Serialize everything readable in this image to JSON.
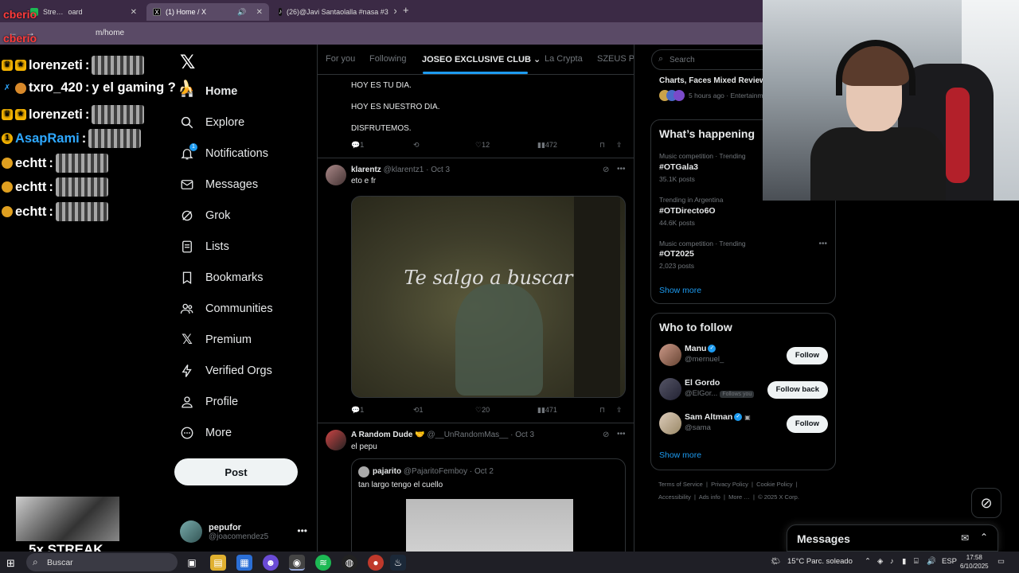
{
  "browser": {
    "tabs": [
      {
        "label": "Stre…",
        "suffix": "oard"
      },
      {
        "label": "(1) Home / X"
      },
      {
        "label": "(26)@Javi Santaolalla #nasa #3"
      }
    ],
    "url": "m/home",
    "new_tab": "+"
  },
  "stream": {
    "chat": [
      {
        "user": "lorenzeti",
        "message": ""
      },
      {
        "user": "txro_420",
        "message": "y el gaming ?"
      },
      {
        "user": "lorenzeti",
        "message": ""
      },
      {
        "user": "AsapRami",
        "message": ""
      },
      {
        "user": "echtt",
        "message": ""
      },
      {
        "user": "echtt",
        "message": ""
      },
      {
        "user": "echtt",
        "message": ""
      }
    ],
    "overlay_tag": "cberio",
    "streak": "5x STREAK",
    "colors": {
      "lorenzeti": "#ffffff",
      "asaprami": "#2ea8ff",
      "echtt": "#ffffff"
    }
  },
  "nav": {
    "items": [
      {
        "label": "Home",
        "icon": "home-icon"
      },
      {
        "label": "Explore",
        "icon": "search-icon"
      },
      {
        "label": "Notifications",
        "icon": "bell-icon",
        "badge": "1"
      },
      {
        "label": "Messages",
        "icon": "mail-icon"
      },
      {
        "label": "Grok",
        "icon": "grok-icon"
      },
      {
        "label": "Lists",
        "icon": "list-icon"
      },
      {
        "label": "Bookmarks",
        "icon": "bookmark-icon"
      },
      {
        "label": "Communities",
        "icon": "people-icon"
      },
      {
        "label": "Premium",
        "icon": "x-icon"
      },
      {
        "label": "Verified Orgs",
        "icon": "bolt-icon"
      },
      {
        "label": "Profile",
        "icon": "person-icon"
      },
      {
        "label": "More",
        "icon": "more-circle-icon"
      }
    ],
    "post_label": "Post",
    "account": {
      "name": "pepufor",
      "handle": "@joacomendez5"
    }
  },
  "timeline": {
    "tabs": [
      "For you",
      "Following",
      "JOSEO EXCLUSIVE CLUB",
      "La Crypta",
      "SZEUS Pe"
    ],
    "active_tab": "JOSEO EXCLUSIVE CLUB",
    "post1": {
      "lines": [
        "HOY ES TU DIA.",
        "HOY ES NUESTRO DIA.",
        "DISFRUTEMOS."
      ],
      "replies": "1",
      "reposts": "",
      "likes": "12",
      "views": "472"
    },
    "post2": {
      "name": "klarentz",
      "handle": "@klarentz1",
      "date": "Oct 3",
      "text": "eto e fr",
      "media_caption": "Te salgo a buscar",
      "replies": "1",
      "reposts": "1",
      "likes": "20",
      "views": "471"
    },
    "post3": {
      "name": "A Random Dude",
      "handle": "@__UnRandomMas__",
      "date": "Oct 3",
      "text": "el pepu",
      "quote": {
        "name": "pajarito",
        "handle": "@PajaritoFemboy",
        "date": "Oct 2",
        "text": "tan largo tengo el cuello"
      }
    }
  },
  "right": {
    "search_placeholder": "Search",
    "top_story": {
      "title": "Charts, Faces Mixed Review",
      "meta": "5 hours ago · Entertainm"
    },
    "happening": {
      "title": "What’s happening",
      "trends": [
        {
          "meta": "Music competition · Trending",
          "name": "#OTGala3",
          "posts": "35.1K posts"
        },
        {
          "meta": "Trending in Argentina",
          "name": "#OTDirecto6O",
          "posts": "44.6K posts"
        },
        {
          "meta": "Music competition · Trending",
          "name": "#OT2025",
          "posts": "2,023 posts"
        }
      ],
      "show_more": "Show more"
    },
    "who_to_follow": {
      "title": "Who to follow",
      "people": [
        {
          "name": "Manu",
          "handle": "@mernuel_",
          "button": "Follow",
          "verified": true
        },
        {
          "name": "El Gordo",
          "handle": "@ElGor...",
          "button": "Follow back",
          "follows_you": "Follows you"
        },
        {
          "name": "Sam Altman",
          "handle": "@sama",
          "button": "Follow",
          "verified": true
        }
      ],
      "show_more": "Show more"
    },
    "footer": {
      "row1": [
        "Terms of Service",
        "Privacy Policy",
        "Cookie Policy"
      ],
      "row2": [
        "Accessibility",
        "Ads info",
        "More …",
        "© 2025 X Corp."
      ]
    }
  },
  "messages_dock": {
    "title": "Messages"
  },
  "taskbar": {
    "search": "Buscar",
    "weather": "15°C  Parc. soleado",
    "lang": "ESP",
    "time": "17:58",
    "date": "6/10/2025"
  }
}
